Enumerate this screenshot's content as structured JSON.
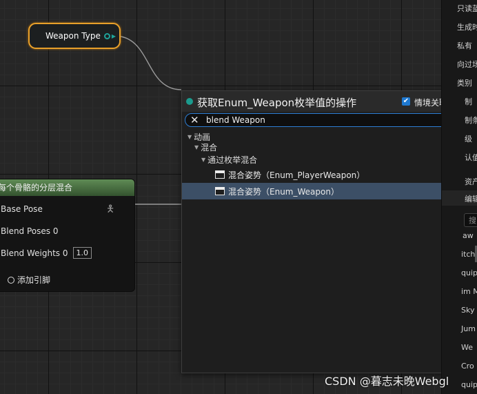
{
  "weapon_node": {
    "label": "Weapon Type"
  },
  "blend_node": {
    "title": "每个骨骼的分层混合",
    "base_pose": "Base Pose",
    "blend_poses": "Blend Poses 0",
    "blend_weights": "Blend Weights 0",
    "blend_weights_value": "1.0",
    "add_pin": "添加引脚"
  },
  "menu": {
    "title": "获取Enum_Weapon枚举值的操作",
    "context_label": "情境关联",
    "context_checked": true,
    "search_value": "blend Weapon",
    "tree": [
      {
        "label": "动画",
        "type": "category"
      },
      {
        "label": "混合",
        "type": "category"
      },
      {
        "label": "通过枚举混合",
        "type": "category"
      },
      {
        "label": "混合姿势（Enum_PlayerWeapon）",
        "type": "function"
      },
      {
        "label": "混合姿势（Enum_Weapon）",
        "type": "function",
        "selected": true
      }
    ]
  },
  "details_panel": {
    "props": [
      "只读蓝",
      "生成时",
      "私有",
      "向过场",
      "类别",
      "制",
      "制条",
      "级",
      "认值",
      "资产",
      "编辑"
    ],
    "search_placeholder": "搜",
    "items": [
      "aw",
      "itch",
      "quip",
      "im M",
      "Sky",
      "Jum",
      "We",
      "Cro",
      "quip"
    ]
  },
  "watermark": "CSDN @暮志未晚Webgl",
  "colors": {
    "selection_outline": "#e8a02a",
    "enum_pin": "#1fa39a",
    "node_header": "#5f8b55",
    "selected_row": "#3c4f66",
    "search_border": "#2d7ed6",
    "checkbox": "#1e78d0"
  }
}
